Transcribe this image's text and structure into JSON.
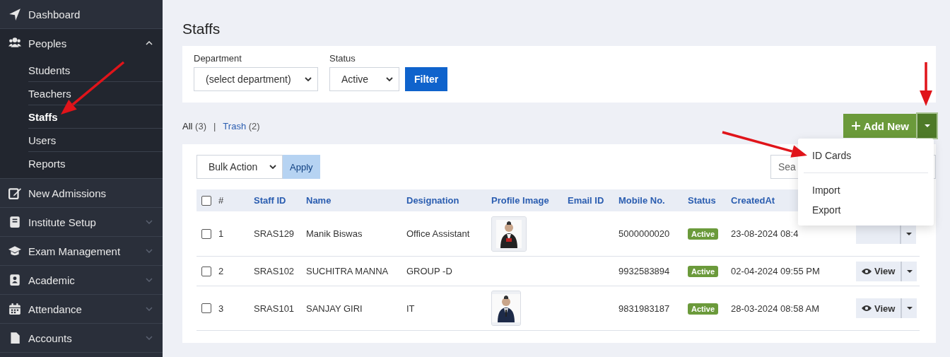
{
  "sidebar": {
    "items": [
      {
        "label": "Dashboard",
        "selected": false
      },
      {
        "label": "Peoples",
        "expanded": true,
        "selected": false,
        "children": [
          {
            "label": "Students",
            "selected": false
          },
          {
            "label": "Teachers",
            "selected": false
          },
          {
            "label": "Staffs",
            "selected": true
          },
          {
            "label": "Users",
            "selected": false
          },
          {
            "label": "Reports",
            "selected": false
          }
        ]
      },
      {
        "label": "New Admissions",
        "selected": false
      },
      {
        "label": "Institute Setup",
        "expanded": false,
        "selected": false
      },
      {
        "label": "Exam Management",
        "expanded": false,
        "selected": false
      },
      {
        "label": "Academic",
        "expanded": false,
        "selected": false
      },
      {
        "label": "Attendance",
        "expanded": false,
        "selected": false
      },
      {
        "label": "Accounts",
        "expanded": false,
        "selected": false
      }
    ]
  },
  "page_title": "Staffs",
  "filters": {
    "department": {
      "label": "Department",
      "value": "(select department)"
    },
    "status": {
      "label": "Status",
      "value": "Active"
    },
    "button": "Filter"
  },
  "views_separator": "|",
  "views": [
    {
      "label": "All",
      "count": "(3)",
      "selected": true
    },
    {
      "label": "Trash",
      "count": "(2)",
      "selected": false
    }
  ],
  "add_button": "Add New",
  "menu": {
    "items": [
      "ID Cards",
      "Import",
      "Export"
    ]
  },
  "bulk": {
    "value": "Bulk Action",
    "button": "Apply"
  },
  "search": {
    "placeholder": "Sea"
  },
  "table": {
    "header_checked": false,
    "columns": [
      "#",
      "Staff ID",
      "Name",
      "Designation",
      "Profile Image",
      "Email ID",
      "Mobile No.",
      "Status",
      "CreatedAt"
    ],
    "rows": [
      {
        "checked": false,
        "num": "1",
        "staff_id": "SRAS129",
        "name": "Manik Biswas",
        "designation": "Office Assistant",
        "mobile": "5000000020",
        "status": "Active",
        "created": "23-08-2024 08:4"
      },
      {
        "checked": false,
        "num": "2",
        "staff_id": "SRAS102",
        "name": "SUCHITRA MANNA",
        "designation": "GROUP -D",
        "mobile": "9932583894",
        "status": "Active",
        "created": "02-04-2024 09:55 PM",
        "action": "View"
      },
      {
        "checked": false,
        "num": "3",
        "staff_id": "SRAS101",
        "name": "SANJAY GIRI",
        "designation": "IT",
        "mobile": "9831983187",
        "status": "Active",
        "created": "28-03-2024 08:58 AM",
        "action": "View"
      }
    ]
  }
}
